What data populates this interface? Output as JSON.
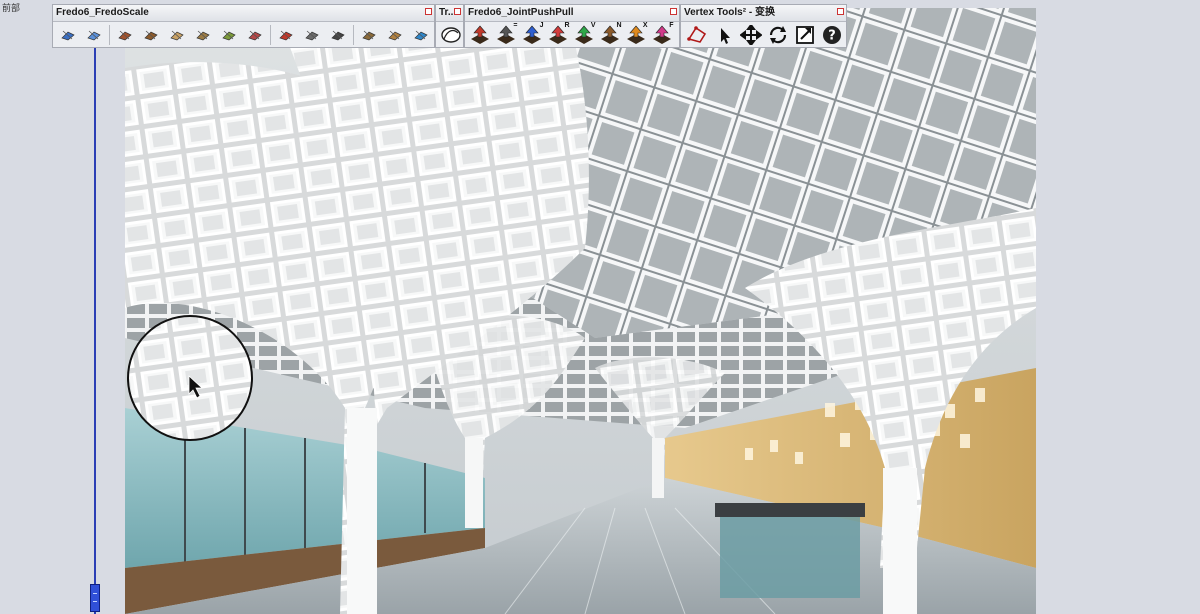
{
  "corner_label": "前部",
  "toolbars": {
    "fredoscale": {
      "title": "Fredo6_FredoScale",
      "icons": [
        "box-scale-icon",
        "box-stretch-icon",
        "box-twist-icon",
        "box-bend-icon",
        "taper-icon",
        "plane-scale-icon",
        "stretch-icon",
        "twist-icon",
        "shear-icon",
        "bend-icon",
        "rotate-icon",
        "radial-bend-icon",
        "untaper-icon",
        "help-icon"
      ]
    },
    "tr": {
      "title": "Tr...",
      "icons": [
        "curve-tool-icon"
      ]
    },
    "jointpushpull": {
      "title": "Fredo6_JointPushPull",
      "buttons": [
        {
          "letter": "",
          "icon": "joint-push-pull-icon"
        },
        {
          "letter": "=",
          "icon": "vector-push-pull-icon"
        },
        {
          "letter": "J",
          "icon": "joint-icon"
        },
        {
          "letter": "R",
          "icon": "round-icon"
        },
        {
          "letter": "V",
          "icon": "vector-icon"
        },
        {
          "letter": "N",
          "icon": "normal-icon"
        },
        {
          "letter": "X",
          "icon": "extrude-icon"
        },
        {
          "letter": "F",
          "icon": "follow-icon"
        }
      ]
    },
    "vertex": {
      "title": "Vertex Tools² - 变换",
      "icons": [
        "vertex-select-icon",
        "pointer-icon",
        "move-icon",
        "rotate-icon",
        "scale-icon",
        "help-icon"
      ]
    }
  },
  "colors": {
    "axis": "#2b3fb5",
    "wood": "#d9b675",
    "structure": "#f5f6f7",
    "ceiling": "#7f868a"
  }
}
